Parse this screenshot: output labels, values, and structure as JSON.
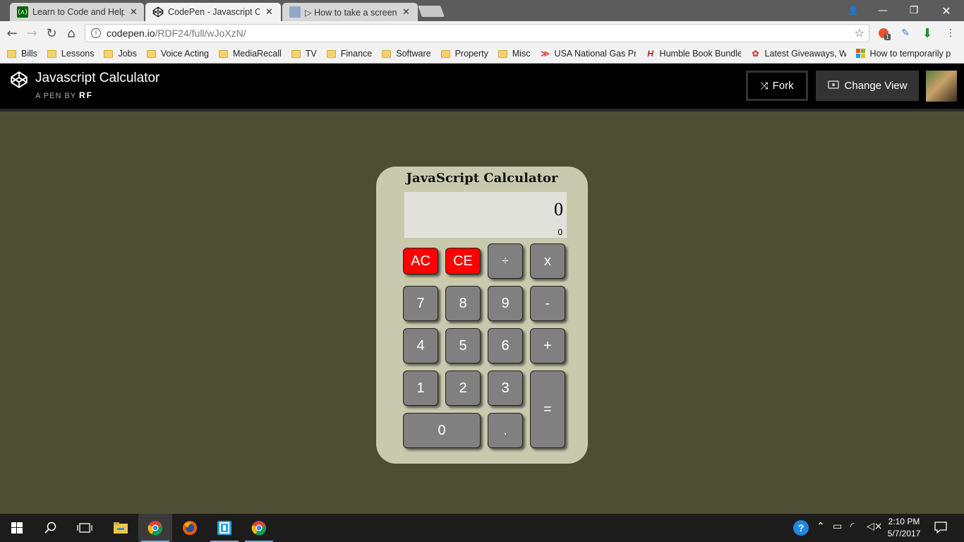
{
  "browser": {
    "tabs": [
      {
        "title": "Learn to Code and Help N",
        "icon": "freecodecamp-icon"
      },
      {
        "title": "CodePen - Javascript Calc",
        "icon": "codepen-icon"
      },
      {
        "title": "▷ How to take a screensh",
        "icon": "screenshot-page-icon"
      }
    ],
    "url_host": "codepen.io",
    "url_path": "/RDF24/full/wJoXzN/",
    "extension_badge": "1",
    "bookmarks": [
      {
        "label": "Bills",
        "icon": "folder-icon"
      },
      {
        "label": "Lessons",
        "icon": "folder-icon"
      },
      {
        "label": "Jobs",
        "icon": "folder-icon"
      },
      {
        "label": "Voice Acting",
        "icon": "folder-icon"
      },
      {
        "label": "MediaRecall",
        "icon": "folder-icon"
      },
      {
        "label": "TV",
        "icon": "folder-icon"
      },
      {
        "label": "Finance",
        "icon": "folder-icon"
      },
      {
        "label": "Software",
        "icon": "folder-icon"
      },
      {
        "label": "Property",
        "icon": "folder-icon"
      },
      {
        "label": "Misc",
        "icon": "folder-icon"
      },
      {
        "label": "USA National Gas Pric",
        "icon": "gasbuddy-icon"
      },
      {
        "label": "Humble Book Bundle:",
        "icon": "humble-icon"
      },
      {
        "label": "Latest Giveaways, Win",
        "icon": "giveaway-icon"
      },
      {
        "label": "How to temporarily p",
        "icon": "windows-icon"
      }
    ]
  },
  "codepen": {
    "title": "Javascript Calculator",
    "by_prefix": "A PEN BY",
    "author": "RF",
    "fork_label": "Fork",
    "change_view_label": "Change View"
  },
  "calculator": {
    "title": "JavaScript Calculator",
    "display_main": "0",
    "display_sub": "0",
    "buttons": {
      "ac": "AC",
      "ce": "CE",
      "divide": "÷",
      "multiply": "x",
      "seven": "7",
      "eight": "8",
      "nine": "9",
      "minus": "-",
      "four": "4",
      "five": "5",
      "six": "6",
      "plus": "+",
      "one": "1",
      "two": "2",
      "three": "3",
      "equals": "=",
      "zero": "0",
      "decimal": "."
    },
    "colors": {
      "clear_buttons": "#ff0000",
      "buttons": "#808080",
      "body": "#c9c9ae",
      "page": "#4e4e35"
    }
  },
  "taskbar": {
    "time": "2:10 PM",
    "date": "5/7/2017"
  }
}
